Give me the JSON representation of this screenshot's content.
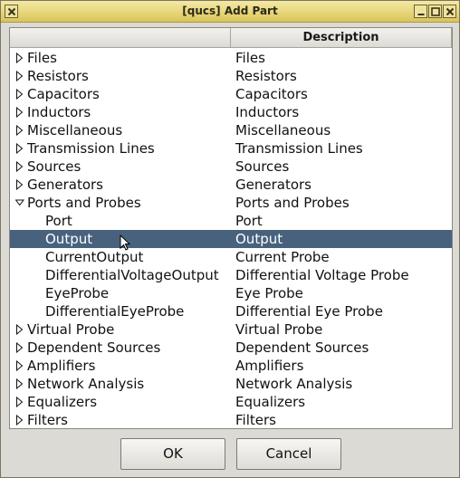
{
  "window": {
    "title": "[qucs] Add Part"
  },
  "tree": {
    "columns": [
      "",
      "Description"
    ],
    "rows": [
      {
        "name": "Files",
        "desc": "Files",
        "arrow": "right"
      },
      {
        "name": "Resistors",
        "desc": "Resistors",
        "arrow": "right"
      },
      {
        "name": "Capacitors",
        "desc": "Capacitors",
        "arrow": "right"
      },
      {
        "name": "Inductors",
        "desc": "Inductors",
        "arrow": "right"
      },
      {
        "name": "Miscellaneous",
        "desc": "Miscellaneous",
        "arrow": "right"
      },
      {
        "name": "Transmission Lines",
        "desc": "Transmission Lines",
        "arrow": "right"
      },
      {
        "name": "Sources",
        "desc": "Sources",
        "arrow": "right"
      },
      {
        "name": "Generators",
        "desc": "Generators",
        "arrow": "right"
      },
      {
        "name": "Ports and Probes",
        "desc": "Ports and Probes",
        "arrow": "down"
      },
      {
        "name": "Port",
        "desc": "Port",
        "child": true
      },
      {
        "name": "Output",
        "desc": "Output",
        "child": true,
        "selected": true
      },
      {
        "name": "CurrentOutput",
        "desc": "Current Probe",
        "child": true
      },
      {
        "name": "DifferentialVoltageOutput",
        "desc": "Differential Voltage Probe",
        "child": true
      },
      {
        "name": "EyeProbe",
        "desc": "Eye Probe",
        "child": true
      },
      {
        "name": "DifferentialEyeProbe",
        "desc": "Differential Eye Probe",
        "child": true
      },
      {
        "name": "Virtual Probe",
        "desc": "Virtual Probe",
        "arrow": "right"
      },
      {
        "name": "Dependent Sources",
        "desc": "Dependent Sources",
        "arrow": "right"
      },
      {
        "name": "Amplifiers",
        "desc": "Amplifiers",
        "arrow": "right"
      },
      {
        "name": "Network Analysis",
        "desc": "Network Analysis",
        "arrow": "right"
      },
      {
        "name": "Equalizers",
        "desc": "Equalizers",
        "arrow": "right"
      },
      {
        "name": "Filters",
        "desc": "Filters",
        "arrow": "right"
      }
    ]
  },
  "buttons": {
    "ok": "OK",
    "cancel": "Cancel"
  },
  "colors": {
    "selection": "#48627e",
    "titlebar": "#e8d67a"
  }
}
